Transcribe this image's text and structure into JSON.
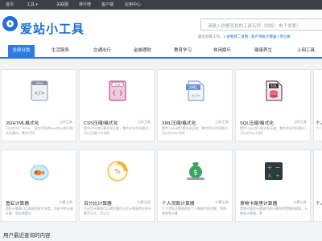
{
  "topbar": {
    "items": [
      "首页",
      "工具 ▾",
      "关联圈",
      "排行榜",
      "客户端",
      "应用中心"
    ]
  },
  "header": {
    "logo_text": "爱站小工具",
    "search_placeholder": "请输入你要查找的工具名称（例如：电子发票）",
    "user_status_prefix": "最近到算工作，",
    "user_status_link": "4 进制转二进制",
    "user_status_sep": "| ",
    "user_status_right": "爸产带帐计算器 | 单位换"
  },
  "categories": [
    "全部分类",
    "生活服务",
    "交通出行",
    "金融理财",
    "教育学习",
    "休闲娱乐",
    "健康养生",
    "上网工具"
  ],
  "cards": [
    {
      "title": "JS/HTML格式化",
      "tag": "上网工具",
      "desc": "可以对JS、HTML、混合代码到html的JS进行格式化美化，整齐代码",
      "icon": "html-js-icon"
    },
    {
      "title": "CSS压缩/格式化",
      "tag": "上网工具",
      "desc": "提供CSS进行格式化压缩，整齐优化代码格式，可以压缩CSS代码",
      "icon": "css-icon"
    },
    {
      "title": "XML压缩/格式化",
      "tag": "上网工具",
      "desc": "提供 XML进行格式化压缩，整齐优化代码格式，可以对XML代码",
      "icon": "xml-icon"
    },
    {
      "title": "SQL压缩/格式化",
      "tag": "上网工具",
      "desc": "提供 SQL进行格式化压缩，整齐优化代码格式，可以对SQL代码",
      "icon": "sql-icon"
    },
    {
      "title": "个人",
      "tag": "",
      "desc": "个人",
      "icon": "partial-icon"
    },
    {
      "title": "鱼缸计算器",
      "tag": "计算工具",
      "desc": "鱼缸计算器可以根据鱼缸的长度，鱼缸中的水量计算，鱼缸需要水",
      "icon": "fishbowl-icon"
    },
    {
      "title": "百分比计算器",
      "tag": "计算工具",
      "desc": "百分比计算器可以帮你算百分比计算器的在线计算百分比，百分比",
      "icon": "percent-icon"
    },
    {
      "title": "个人贷款计算器",
      "tag": "计算工具",
      "desc": "个人贷款计算器帮助个人根据贷款金额，利率、期限等计算",
      "icon": "loan-icon"
    },
    {
      "title": "食物卡路里计算器",
      "tag": "计算工具",
      "desc": "食物卡路里计算器用来计算各种食物热量值，卡路里计算器，帮",
      "icon": "calorie-icon"
    },
    {
      "title": "个人",
      "tag": "",
      "desc": "",
      "icon": "partial-icon"
    }
  ],
  "section_title": "用户最近查询的内容",
  "colors": {
    "brand": "#1e6fd9",
    "topbar": "#3c3f45",
    "active_tab": "#2f7be6"
  }
}
